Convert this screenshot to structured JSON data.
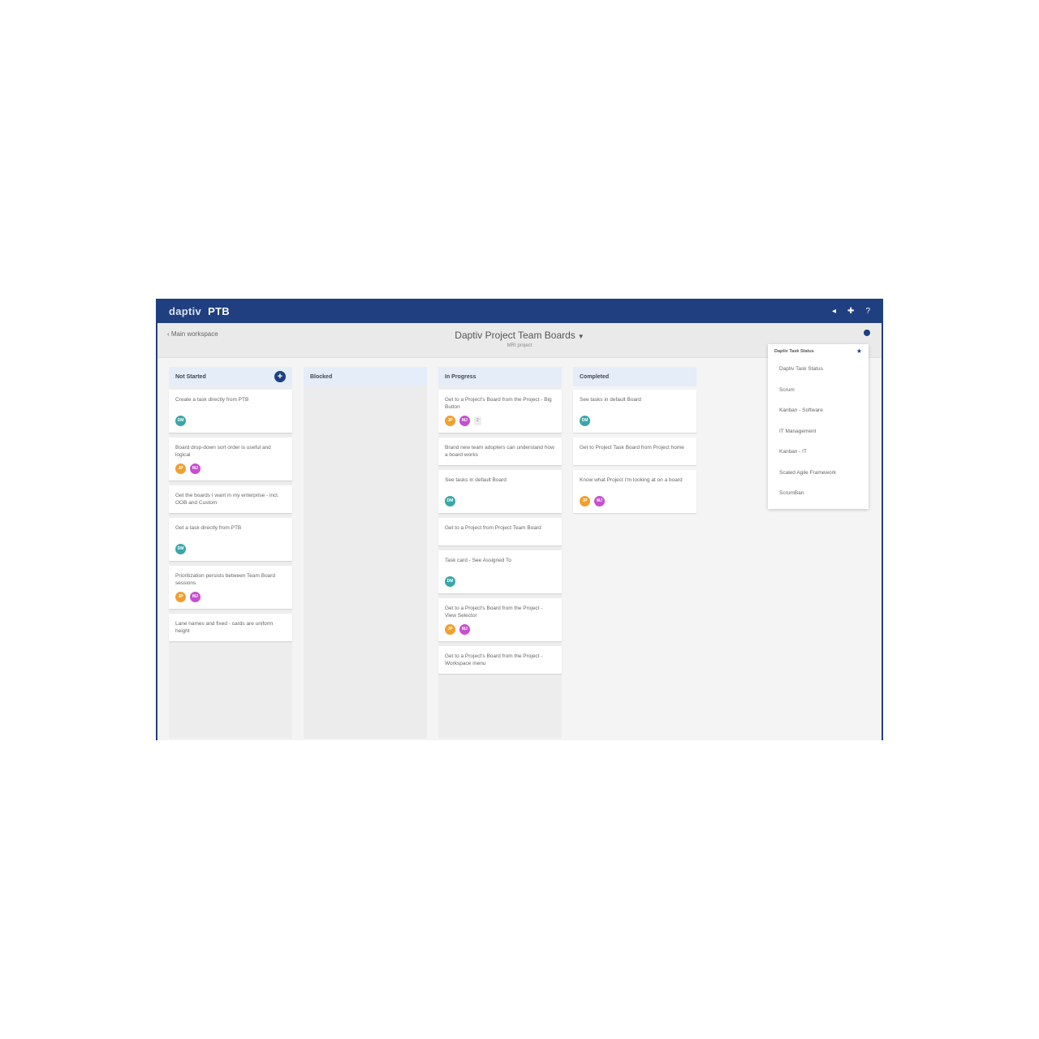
{
  "app": {
    "logo": "daptiv",
    "product": "PTB",
    "header_icons": [
      "bell-icon",
      "gear-icon",
      "help-icon"
    ],
    "header_icon_glyphs": [
      "◂",
      "✚",
      "?"
    ]
  },
  "subheader": {
    "back_link": "Main workspace",
    "title": "Daptiv Project Team Boards",
    "subtitle": "MRI project"
  },
  "colors": {
    "brand": "#1f3f80",
    "teal": "#3aa6a8",
    "orange": "#f0a030",
    "magenta": "#c64fcf"
  },
  "columns": [
    {
      "title": "Not Started",
      "cards": [
        {
          "text": "Create a task directly from PTB",
          "avatars": [
            {
              "initials": "DM",
              "color": "teal"
            }
          ]
        },
        {
          "text": "Board drop-down sort order is useful and logical",
          "avatars": [
            {
              "initials": "JP",
              "color": "orange"
            },
            {
              "initials": "MJ",
              "color": "magenta"
            }
          ]
        },
        {
          "text": "Get the boards I want in my enterprise - incl. OOB and Custom",
          "avatars": []
        },
        {
          "text": "Get a task directly from PTB",
          "avatars": [
            {
              "initials": "DM",
              "color": "teal"
            }
          ]
        },
        {
          "text": "Prioritization persists between Team Board sessions",
          "avatars": [
            {
              "initials": "JP",
              "color": "orange"
            },
            {
              "initials": "MJ",
              "color": "magenta"
            }
          ]
        },
        {
          "text": "Lane names and fixed - cards are uniform height",
          "avatars": []
        }
      ]
    },
    {
      "title": "Blocked",
      "cards": []
    },
    {
      "title": "In Progress",
      "cards": [
        {
          "text": "Get to a Project's Board from the Project - Big Button",
          "avatars": [
            {
              "initials": "JP",
              "color": "orange"
            },
            {
              "initials": "MJ",
              "color": "magenta"
            }
          ],
          "badge": "2"
        },
        {
          "text": "Brand new team adopters can understand how a board works",
          "avatars": []
        },
        {
          "text": "See tasks in default Board",
          "avatars": [
            {
              "initials": "DM",
              "color": "teal"
            }
          ]
        },
        {
          "text": "Get to a Project from Project Team Board",
          "avatars": []
        },
        {
          "text": "Task card - See Assigned To",
          "avatars": [
            {
              "initials": "DM",
              "color": "teal"
            }
          ]
        },
        {
          "text": "Get to a Project's Board from the Project - View Selector",
          "avatars": [
            {
              "initials": "JP",
              "color": "orange"
            },
            {
              "initials": "MJ",
              "color": "magenta"
            }
          ]
        },
        {
          "text": "Get to a Project's Board from the Project - Workspace menu",
          "avatars": []
        }
      ]
    },
    {
      "title": "Completed",
      "cards": [
        {
          "text": "See tasks in default Board",
          "avatars": [
            {
              "initials": "DM",
              "color": "teal"
            }
          ]
        },
        {
          "text": "Get to Project Task Board from Project home",
          "avatars": []
        },
        {
          "text": "Know what Project I'm looking at on a board",
          "avatars": [
            {
              "initials": "JP",
              "color": "orange"
            },
            {
              "initials": "MJ",
              "color": "magenta"
            }
          ]
        }
      ]
    }
  ],
  "dropdown": {
    "header": "Daptiv Task Status",
    "items": [
      "Daptiv Task Status",
      "Scrum",
      "Kanban - Software",
      "IT Management",
      "Kanban - IT",
      "Scaled Agile Framework",
      "ScrumBan"
    ]
  }
}
